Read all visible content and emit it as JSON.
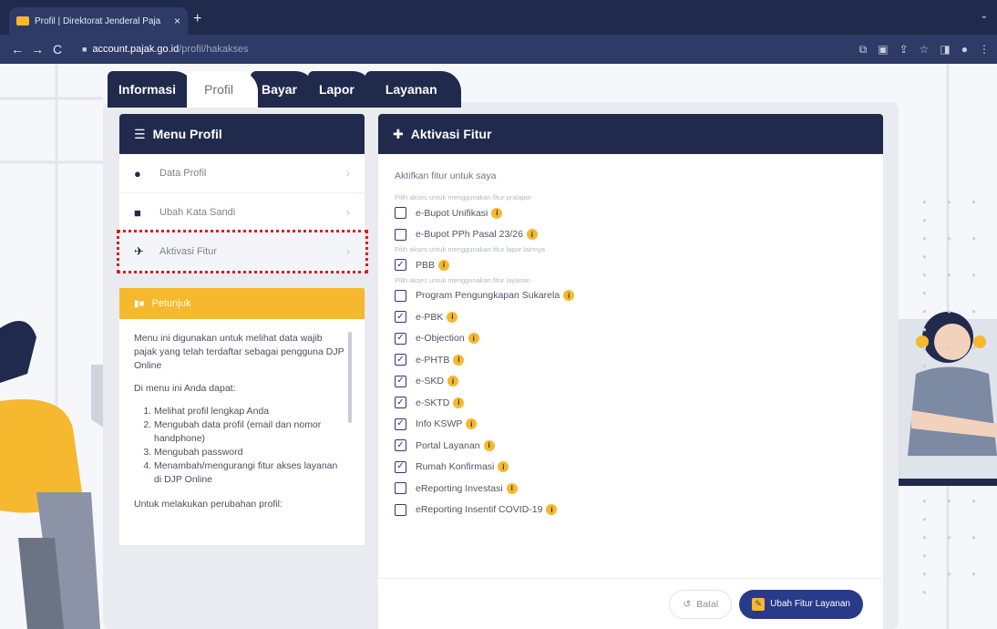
{
  "browser": {
    "tab_title": "Profil | Direktorat Jenderal Paja",
    "url_host": "account.pajak.go.id",
    "url_path": "/profil/hakakses"
  },
  "top_tabs": [
    {
      "label": "Informasi"
    },
    {
      "label": "Profil"
    },
    {
      "label": "Bayar"
    },
    {
      "label": "Lapor"
    },
    {
      "label": "Layanan"
    }
  ],
  "left": {
    "menu_title": "Menu Profil",
    "items": [
      {
        "label": "Data Profil",
        "icon": "user-icon"
      },
      {
        "label": "Ubah Kata Sandi",
        "icon": "lock-icon"
      },
      {
        "label": "Aktivasi Fitur",
        "icon": "pin-icon"
      }
    ],
    "petunjuk_title": "Petunjuk",
    "petunjuk_p1": "Menu ini digunakan untuk melihat data wajib pajak yang telah terdaftar sebagai pengguna DJP Online",
    "petunjuk_p2": "Di menu ini Anda dapat:",
    "petunjuk_list": [
      "Melihat profil lengkap Anda",
      "Mengubah data profil (email dan nomor handphone)",
      "Mengubah password",
      "Menambah/mengurangi fitur akses layanan di DJP Online"
    ],
    "petunjuk_p3": "Untuk melakukan perubahan profil:"
  },
  "right": {
    "title": "Aktivasi Fitur",
    "subtitle": "Aktifkan fitur untuk saya",
    "section_prelapor": "Pilih akses untuk menggunakan fitur pralapor",
    "section_lapor": "Pilih akses untuk menggunakan fitur lapor lainnya",
    "section_layanan": "Pilih akses untuk menggunakan fitur layanan",
    "prelapor": [
      {
        "label": "e-Bupot Unifikasi",
        "checked": false
      },
      {
        "label": "e-Bupot PPh Pasal 23/26",
        "checked": false
      }
    ],
    "lapor": [
      {
        "label": "PBB",
        "checked": true
      }
    ],
    "layanan": [
      {
        "label": "Program Pengungkapan Sukarela",
        "checked": false
      },
      {
        "label": "e-PBK",
        "checked": true
      },
      {
        "label": "e-Objection",
        "checked": true
      },
      {
        "label": "e-PHTB",
        "checked": true
      },
      {
        "label": "e-SKD",
        "checked": true
      },
      {
        "label": "e-SKTD",
        "checked": true
      },
      {
        "label": "Info KSWP",
        "checked": true
      },
      {
        "label": "Portal Layanan",
        "checked": true
      },
      {
        "label": "Rumah Konfirmasi",
        "checked": true
      },
      {
        "label": "eReporting Investasi",
        "checked": false
      },
      {
        "label": "eReporting Insentif COVID-19",
        "checked": false
      }
    ],
    "btn_batal": "Batal",
    "btn_ubah": "Ubah Fitur Layanan"
  },
  "colors": {
    "navy": "#1f2a4d",
    "accent": "#f5b82e",
    "highlight": "#d6201f",
    "button": "#283a8a"
  }
}
